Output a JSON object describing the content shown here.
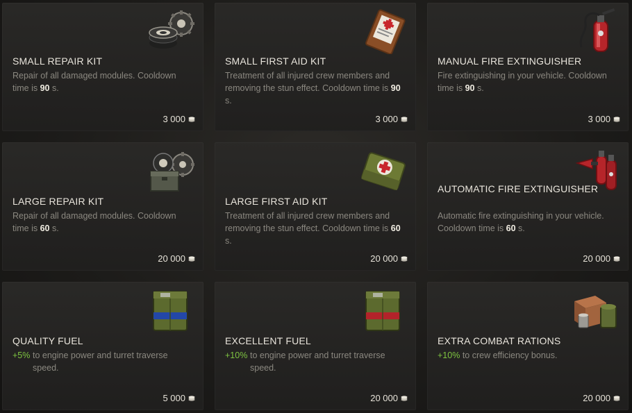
{
  "cards": [
    {
      "title": "SMALL REPAIR KIT",
      "desc_prefix": "Repair of all damaged modules. Cooldown time is ",
      "desc_value": "90",
      "desc_suffix": " s.",
      "price": "3 000",
      "icon": "repair-kit-icon"
    },
    {
      "title": "SMALL FIRST AID KIT",
      "desc_prefix": "Treatment of all injured crew members and removing the stun effect. Cooldown time is ",
      "desc_value": "90",
      "desc_suffix": " s.",
      "price": "3 000",
      "icon": "first-aid-pouch-icon"
    },
    {
      "title": "MANUAL FIRE EXTINGUISHER",
      "desc_prefix": "Fire extinguishing in your vehicle. Cooldown time is ",
      "desc_value": "90",
      "desc_suffix": " s.",
      "price": "3 000",
      "icon": "fire-extinguisher-icon"
    },
    {
      "title": "LARGE REPAIR KIT",
      "desc_prefix": "Repair of all damaged modules. Cooldown time is ",
      "desc_value": "60",
      "desc_suffix": " s.",
      "price": "20 000",
      "icon": "large-repair-kit-icon"
    },
    {
      "title": "LARGE FIRST AID KIT",
      "desc_prefix": "Treatment of all injured crew members and removing the stun effect. Cooldown time is ",
      "desc_value": "60",
      "desc_suffix": " s.",
      "price": "20 000",
      "icon": "first-aid-case-icon"
    },
    {
      "title": "AUTOMATIC FIRE EXTINGUISHER",
      "desc_prefix": "Automatic fire extinguishing in your vehicle. Cooldown time is ",
      "desc_value": "60",
      "desc_suffix": " s.",
      "price": "20 000",
      "icon": "automatic-extinguisher-icon"
    },
    {
      "title": "QUALITY FUEL",
      "bonus": "+5%",
      "desc_text": "to engine power and turret traverse speed.",
      "price": "5 000",
      "icon": "fuel-can-blue-icon"
    },
    {
      "title": "EXCELLENT FUEL",
      "bonus": "+10%",
      "desc_text": "to engine power and turret traverse speed.",
      "price": "20 000",
      "icon": "fuel-can-red-icon"
    },
    {
      "title": "EXTRA COMBAT RATIONS",
      "bonus": "+10%",
      "desc_text": "to crew efficiency bonus.",
      "price": "20 000",
      "icon": "rations-icon"
    }
  ],
  "colors": {
    "title": "#e9e5dc",
    "desc": "#8b8880",
    "highlight": "#f1ede2",
    "bonus": "#7ec441",
    "price": "#e6e2d8"
  }
}
